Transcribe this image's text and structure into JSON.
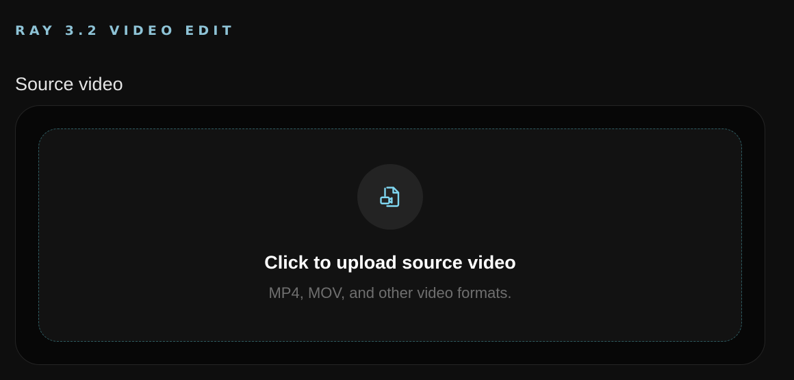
{
  "app": {
    "title": "RAY 3.2 VIDEO EDIT"
  },
  "source": {
    "label": "Source video",
    "upload": {
      "title": "Click to upload source video",
      "hint": "MP4, MOV, and other video formats.",
      "icon": "file-video-icon"
    }
  },
  "colors": {
    "accent": "#8ec3d6",
    "icon": "#7fd6f0",
    "dashed_border": "#2e5d63"
  }
}
